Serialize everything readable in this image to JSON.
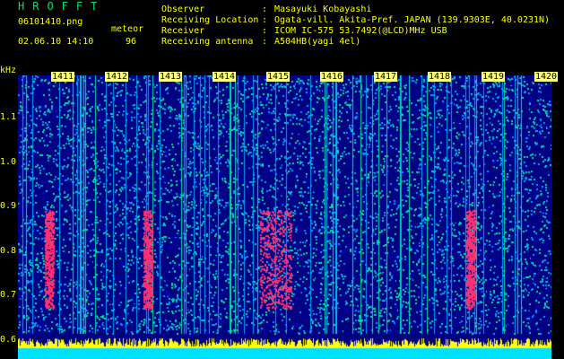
{
  "header": {
    "title": "HROFFT",
    "file": "06101410.png",
    "date_time": "02.06.10 14:10",
    "meteor_label": "meteor",
    "meteor_count": "96"
  },
  "info": [
    {
      "label": "Observer",
      "value": "Masayuki Kobayashi"
    },
    {
      "label": "Receiving Location",
      "value": "Ogata-vill. Akita-Pref. JAPAN (139.9303E, 40.0231N)"
    },
    {
      "label": "Receiver",
      "value": "ICOM IC-575 53.7492(@LCD)MHz USB"
    },
    {
      "label": "Receiving antenna",
      "value": "A504HB(yagi 4el)"
    }
  ],
  "spectrogram": {
    "y_unit": "kHz",
    "y_ticks": [
      "1.1",
      "1.0",
      "0.9",
      "0.8",
      "0.7",
      "0.6"
    ],
    "x_ticks": [
      "1411",
      "1412",
      "1413",
      "1414",
      "1415",
      "1416",
      "1417",
      "1418",
      "1419",
      "1420"
    ],
    "colors": {
      "background": "#000080",
      "noise_low": "#0000c0",
      "noise_mid": "#00a0ff",
      "noise_high": "#00e0a0",
      "hot": "#ff3070",
      "signal": "#ffff00",
      "base": "#00e0ff"
    }
  }
}
